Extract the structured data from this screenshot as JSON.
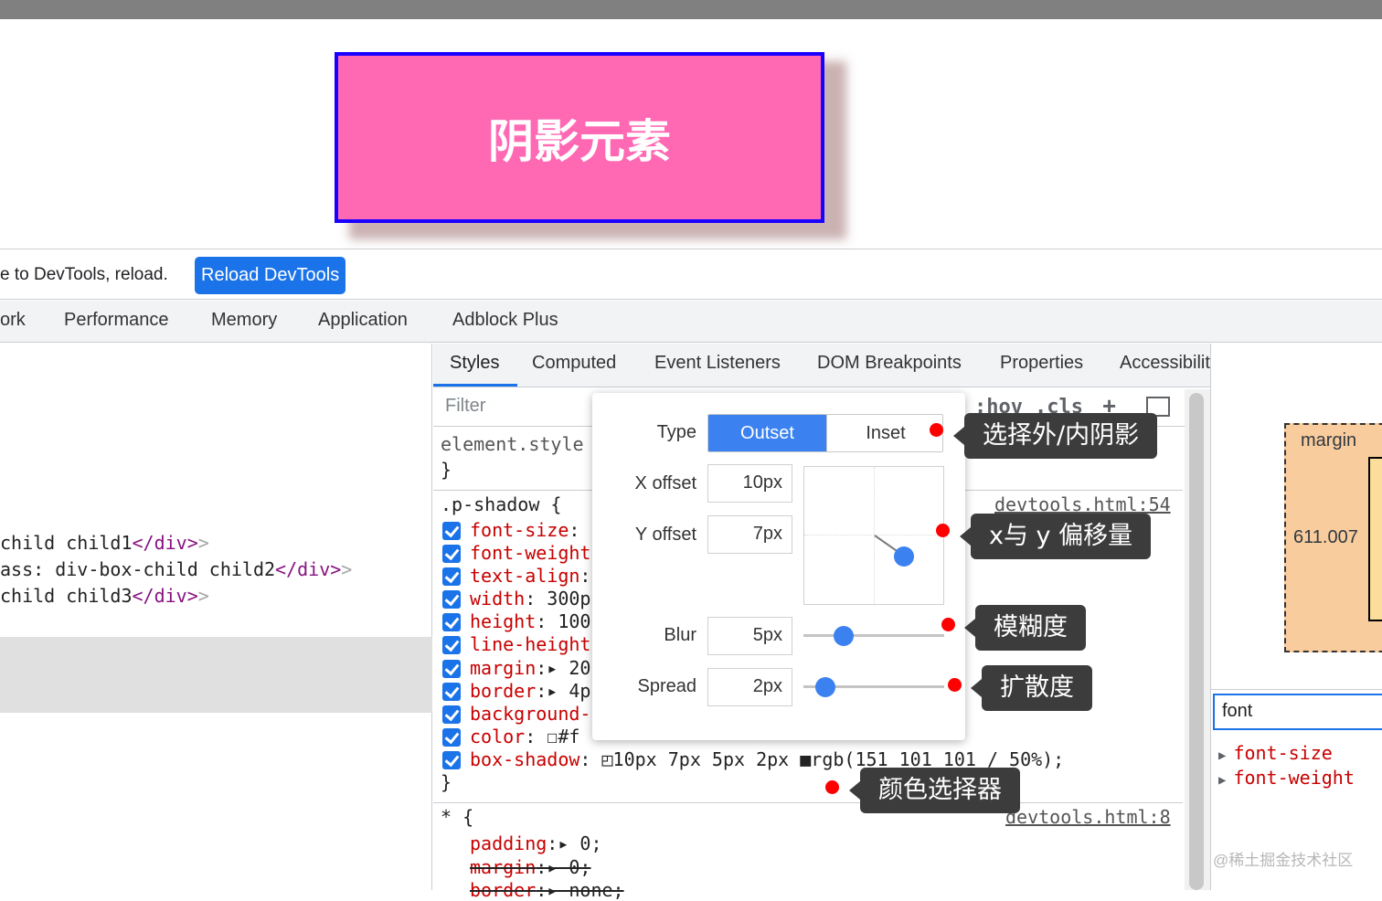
{
  "viewport": {
    "shadow_text": "阴影元素"
  },
  "infobar": {
    "message": "e to DevTools, reload.",
    "reload_label": "Reload DevTools"
  },
  "main_tabs": [
    "ork",
    "Performance",
    "Memory",
    "Application",
    "Adblock Plus"
  ],
  "elements": {
    "lines": [
      {
        "prefix": "child child1",
        "close": "</div>",
        "gt": ">"
      },
      {
        "prefix": "ass: div-box-child child2",
        "close": "</div>",
        "gt": ">"
      },
      {
        "prefix": "child child3",
        "close": "</div>",
        "gt": ">"
      }
    ]
  },
  "styles_tabs": [
    "Styles",
    "Computed",
    "Event Listeners",
    "DOM Breakpoints",
    "Properties",
    "Accessibility"
  ],
  "filter": {
    "placeholder": "Filter",
    "hov": ":hov",
    "cls": ".cls",
    "plus": "+"
  },
  "rules": {
    "element_style": "element.style",
    "close_brace": "}",
    "p_shadow_selector": ".p-shadow {",
    "p_shadow_source": "devtools.html:54",
    "declarations": [
      {
        "name": "font-size",
        "value": ":"
      },
      {
        "name": "font-weight",
        "value": ""
      },
      {
        "name": "text-align",
        "value": ":"
      },
      {
        "name": "width",
        "value": ": 300p"
      },
      {
        "name": "height",
        "value": ": 100"
      },
      {
        "name": "line-height",
        "value": ""
      },
      {
        "name": "margin",
        "value": ":▸ 20"
      },
      {
        "name": "border",
        "value": ":▸ 4p"
      },
      {
        "name": "background-",
        "value": ""
      },
      {
        "name": "color",
        "value": ": ☐#f"
      },
      {
        "name": "box-shadow",
        "value": ": ◰10px 7px 5px 2px ■rgb(151 101 101 / 50%);"
      }
    ],
    "universal_selector": "* {",
    "universal_source": "devtools.html:8",
    "universal_declarations": [
      {
        "name": "padding",
        "value": ":▸ 0;"
      },
      {
        "name": "margin",
        "value": ":▸ 0;"
      },
      {
        "name": "border",
        "value": ":▸ none;"
      }
    ]
  },
  "shadow_editor": {
    "type_label": "Type",
    "outset": "Outset",
    "inset": "Inset",
    "x_label": "X offset",
    "x_value": "10px",
    "y_label": "Y offset",
    "y_value": "7px",
    "blur_label": "Blur",
    "blur_value": "5px",
    "spread_label": "Spread",
    "spread_value": "2px"
  },
  "callouts": {
    "type": "选择外/内阴影",
    "xy": "x与 y 偏移量",
    "blur": "模糊度",
    "spread": "扩散度",
    "color": "颜色选择器"
  },
  "computed": {
    "margin_label": "margin",
    "margin_value": "611.007",
    "filter_value": "font",
    "props": [
      "font-size",
      "font-weight"
    ],
    "watermark": "@稀土掘金技术社区"
  },
  "colors": {
    "accent": "#1a73e8",
    "pink": "#ff69b4",
    "box_border": "#1a00ff",
    "callout_bg": "#3c3c3c",
    "dot": "#ff0000"
  }
}
